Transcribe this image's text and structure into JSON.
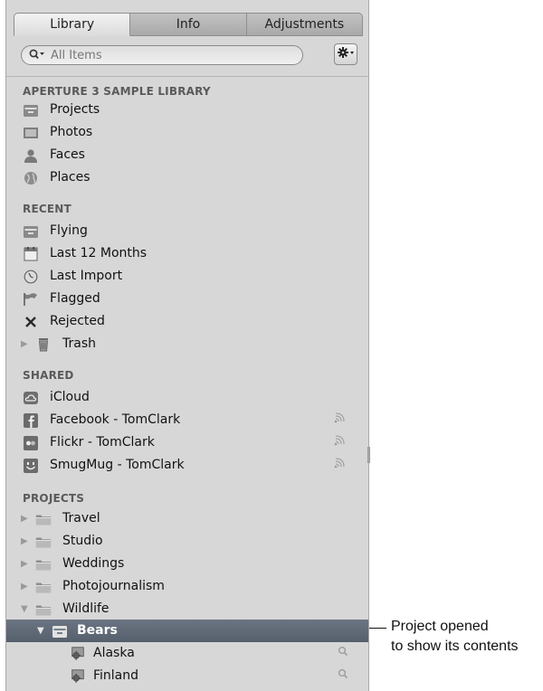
{
  "tabs": [
    {
      "label": "Library",
      "active": true
    },
    {
      "label": "Info",
      "active": false
    },
    {
      "label": "Adjustments",
      "active": false
    }
  ],
  "search": {
    "placeholder": "All Items",
    "value": ""
  },
  "sections": {
    "library": {
      "header": "APERTURE 3 SAMPLE LIBRARY",
      "items": [
        {
          "label": "Projects",
          "icon": "project-box-icon"
        },
        {
          "label": "Photos",
          "icon": "photo-frame-icon"
        },
        {
          "label": "Faces",
          "icon": "person-silhouette-icon"
        },
        {
          "label": "Places",
          "icon": "globe-icon"
        }
      ]
    },
    "recent": {
      "header": "RECENT",
      "items": [
        {
          "label": "Flying",
          "icon": "project-box-icon"
        },
        {
          "label": "Last 12 Months",
          "icon": "calendar-icon"
        },
        {
          "label": "Last Import",
          "icon": "clock-icon"
        },
        {
          "label": "Flagged",
          "icon": "flag-icon"
        },
        {
          "label": "Rejected",
          "icon": "x-mark-icon"
        },
        {
          "label": "Trash",
          "icon": "trash-icon"
        }
      ]
    },
    "shared": {
      "header": "SHARED",
      "items": [
        {
          "label": "iCloud",
          "icon": "cloud-icon"
        },
        {
          "label": "Facebook - TomClark",
          "icon": "facebook-icon"
        },
        {
          "label": "Flickr - TomClark",
          "icon": "flickr-icon"
        },
        {
          "label": "SmugMug - TomClark",
          "icon": "smugmug-icon"
        }
      ]
    },
    "projects": {
      "header": "PROJECTS",
      "items": [
        {
          "label": "Travel",
          "icon": "folder-icon"
        },
        {
          "label": "Studio",
          "icon": "folder-icon"
        },
        {
          "label": "Weddings",
          "icon": "folder-icon"
        },
        {
          "label": "Photojournalism",
          "icon": "folder-icon"
        },
        {
          "label": "Wildlife",
          "icon": "folder-icon"
        },
        {
          "label": "Bears",
          "icon": "project-box-icon",
          "selected": true
        },
        {
          "label": "Alaska",
          "icon": "smart-album-gear-icon"
        },
        {
          "label": "Finland",
          "icon": "smart-album-gear-icon"
        }
      ]
    }
  },
  "callout": {
    "line1": "Project opened",
    "line2": "to show its contents"
  },
  "colors": {
    "panel_bg": "#d7d7d7",
    "selection": "#5f6875",
    "header_text": "#5a5a5a"
  }
}
